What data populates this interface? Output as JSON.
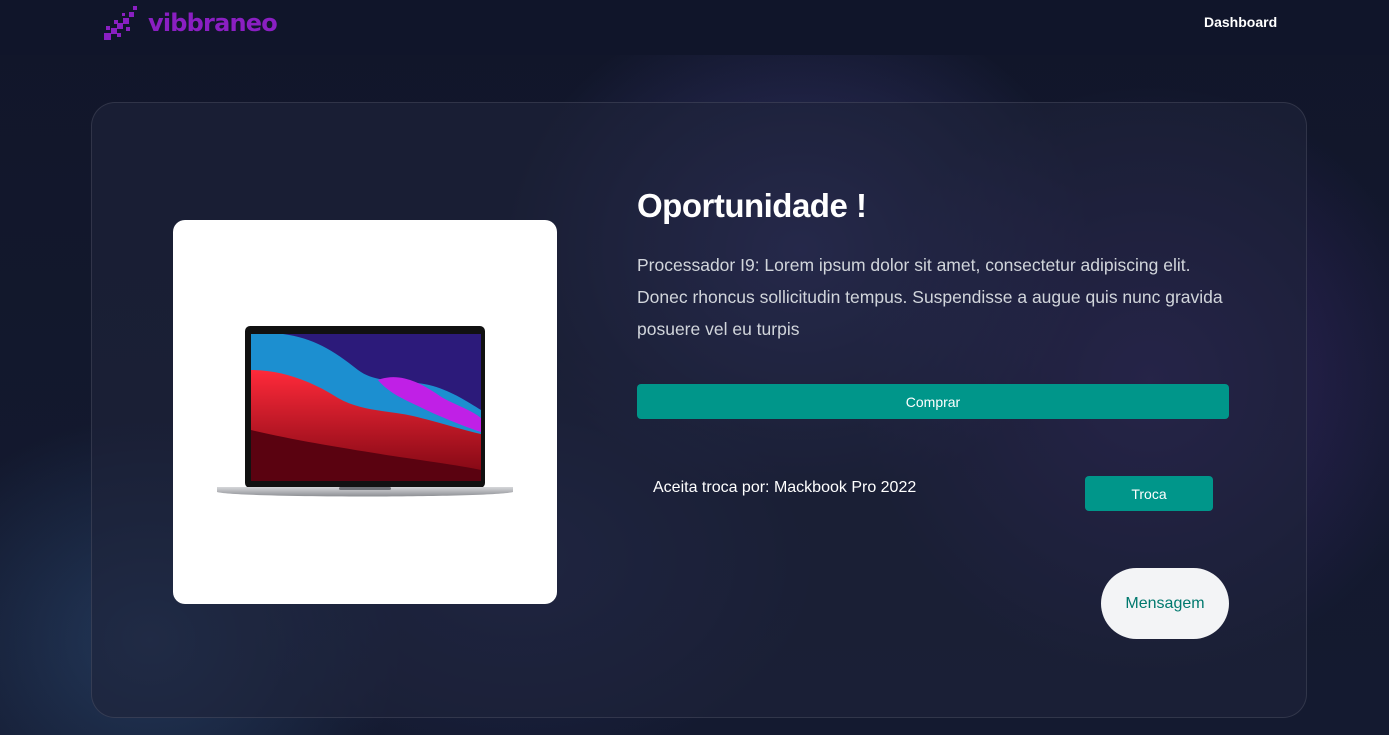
{
  "header": {
    "logo_text": "vibbraneo",
    "logo_icon": "pixel-stairs-logo-icon",
    "nav": {
      "dashboard_label": "Dashboard"
    }
  },
  "product": {
    "image_icon": "laptop-image",
    "title": "Oportunidade !",
    "description": "Processador I9: Lorem ipsum dolor sit amet, consectetur adipiscing elit. Donec rhoncus sollicitudin tempus. Suspendisse a augue quis nunc gravida posuere vel eu turpis",
    "buy_label": "Comprar",
    "exchange_text": "Aceita troca por: Mackbook Pro 2022",
    "exchange_label": "Troca",
    "message_label": "Mensagem"
  },
  "colors": {
    "brand": "#8a1fc2",
    "accent": "#00968a",
    "background": "#141a2d",
    "card": "#1e243a"
  }
}
